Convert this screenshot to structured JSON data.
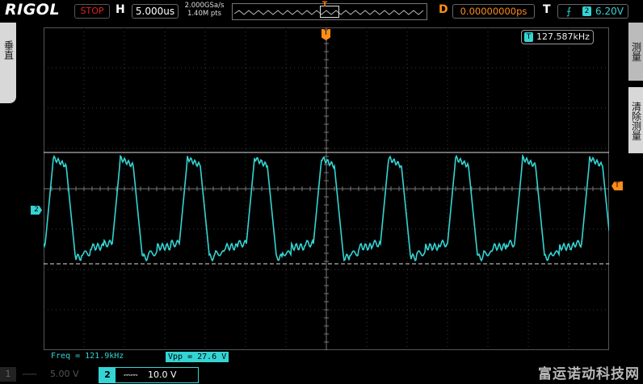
{
  "header": {
    "brand": "RIGOL",
    "run_state": "STOP",
    "horizontal_label": "H",
    "timebase": "5.000us",
    "sample_rate": "2.000GSa/s",
    "memory_depth": "1.40M pts",
    "trigger_marker": "T",
    "delay_label": "D",
    "delay": "0.00000000ps",
    "trigger_label": "T",
    "trigger_source": "2",
    "trigger_level": "6.20V"
  },
  "side_menu": {
    "left_tab": "垂直",
    "right_tab_1": "测量",
    "right_tab_2": "清除测量"
  },
  "screen": {
    "counter_icon": "T",
    "counter_value": "127.587kHz",
    "ch2_marker": "2",
    "trigger_level_marker": "T",
    "trigger_position_marker": "T"
  },
  "measurements": {
    "freq": "Freq = 121.9kHz",
    "vpp": "Vpp = 27.6 V"
  },
  "channels": [
    {
      "number": "1",
      "coupling": "⎓⎓",
      "scale": "5.00 V",
      "active": false
    },
    {
      "number": "2",
      "coupling": "⎓⎓",
      "scale": "10.0 V",
      "active": true
    }
  ],
  "watermark": "富运诺动科技网",
  "colors": {
    "ch2": "#35d4d4",
    "trigger": "#ff8c1a",
    "stop": "#e02020"
  }
}
